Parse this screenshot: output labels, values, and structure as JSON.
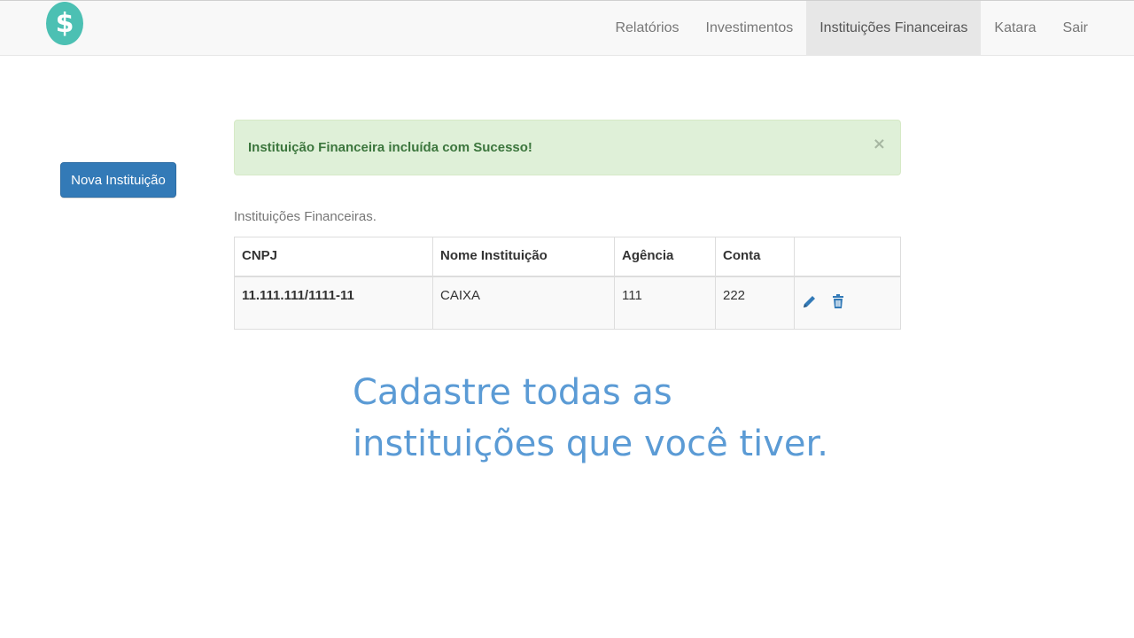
{
  "navbar": {
    "logo_icon": "dollar-sign-icon",
    "logo_symbol": "$",
    "items": [
      {
        "label": "Relatórios"
      },
      {
        "label": "Investimentos"
      },
      {
        "label": "Instituições Financeiras",
        "active": true
      },
      {
        "label": "Katara"
      },
      {
        "label": "Sair"
      }
    ]
  },
  "actions": {
    "new_button_label": "Nova Instituição"
  },
  "alert": {
    "message": "Instituição Financeira incluída com Sucesso!",
    "close_symbol": "×"
  },
  "table": {
    "caption": "Instituições Financeiras.",
    "headers": [
      "CNPJ",
      "Nome Instituição",
      "Agência",
      "Conta",
      ""
    ],
    "rows": [
      {
        "cnpj": "11.111.111/1111-11",
        "nome": "CAIXA",
        "agencia": "111",
        "conta": "222",
        "actions": [
          "pencil-icon",
          "trash-icon"
        ]
      }
    ]
  },
  "promo": {
    "line1": "Cadastre todas as",
    "line2": "instituições que você tiver."
  },
  "colors": {
    "primary": "#337ab7",
    "success_bg": "#dff0d8",
    "success_text": "#3c763d",
    "logo": "#4cc0b3",
    "promo_text": "#5b9bd5"
  }
}
